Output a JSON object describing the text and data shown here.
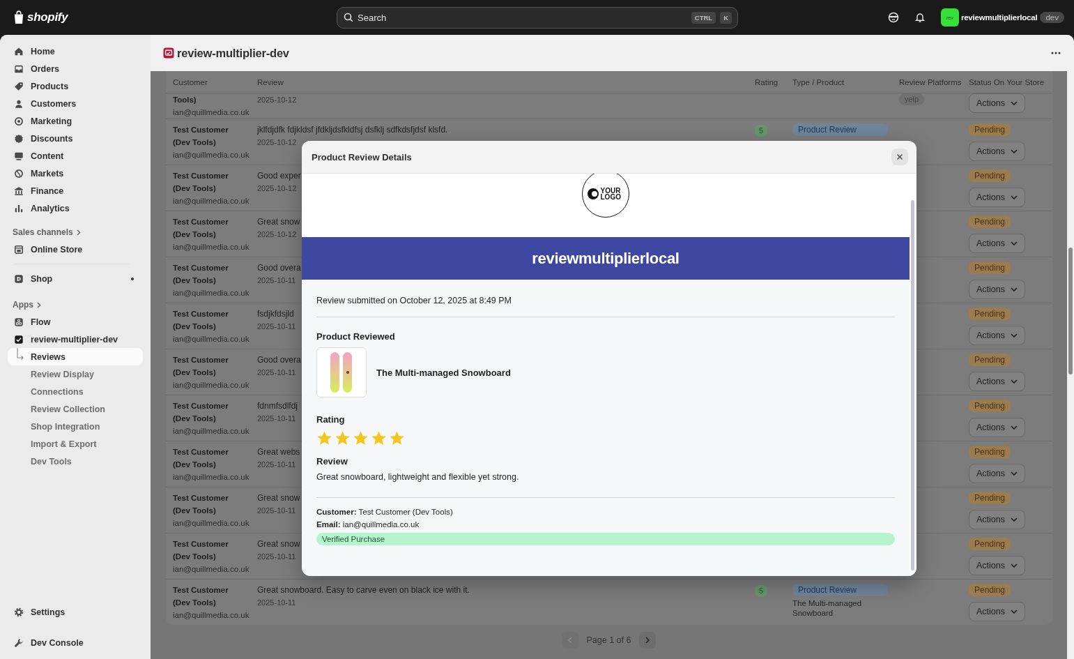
{
  "topbar": {
    "logo_text": "shopify",
    "search": {
      "placeholder": "Search",
      "shortcut": [
        "CTRL",
        "K"
      ]
    },
    "store": {
      "avatar_text": "rev",
      "name": "reviewmultiplierlocal",
      "badge": "dev"
    }
  },
  "sidebar": {
    "items": [
      {
        "label": "Home",
        "selected": false
      },
      {
        "label": "Orders",
        "selected": false
      },
      {
        "label": "Products",
        "selected": false
      },
      {
        "label": "Customers",
        "selected": false
      },
      {
        "label": "Marketing",
        "selected": false
      },
      {
        "label": "Discounts",
        "selected": false
      },
      {
        "label": "Content",
        "selected": false
      },
      {
        "label": "Markets",
        "selected": false
      },
      {
        "label": "Finance",
        "selected": false
      },
      {
        "label": "Analytics",
        "selected": false
      }
    ],
    "sales_channels": {
      "title": "Sales channels",
      "items": [
        {
          "label": "Online Store",
          "selected": false
        }
      ]
    },
    "pinned": [
      {
        "label": "Shop",
        "selected": false
      }
    ],
    "apps": {
      "title": "Apps",
      "items": [
        {
          "label": "Flow",
          "selected": false
        },
        {
          "label": "review-multiplier-dev",
          "selected": false,
          "expanded": true,
          "children": [
            {
              "label": "Reviews",
              "selected": true
            },
            {
              "label": "Review Display",
              "selected": false
            },
            {
              "label": "Connections",
              "selected": false
            },
            {
              "label": "Review Collection",
              "selected": false
            },
            {
              "label": "Shop Integration",
              "selected": false
            },
            {
              "label": "Import & Export",
              "selected": false
            },
            {
              "label": "Dev Tools",
              "selected": false
            }
          ]
        }
      ]
    },
    "footer_items": [
      {
        "label": "Settings",
        "selected": false
      },
      {
        "label": "Dev Console",
        "selected": false
      }
    ]
  },
  "page": {
    "title": "review-multiplier-dev"
  },
  "table": {
    "columns": [
      "Customer",
      "Review",
      "Rating",
      "Type / Product",
      "Review Platforms",
      "Status On Your Store"
    ],
    "rows": [
      {
        "customer": "Tools)",
        "email": "ian@quillmedia.co.uk",
        "date": "2025-10-12",
        "platforms": [
          "yelp"
        ],
        "actions": "Actions"
      },
      {
        "customer": "Test Customer (Dev Tools)",
        "email": "ian@quillmedia.co.uk",
        "review": "jklfdjdfk fdjkldsf jfdkljdsfkldfsj dsfklj sdfkdsfjdsf klsfd.",
        "date": "2025-10-12",
        "rating": "5",
        "type": "Product Review",
        "status": "Pending",
        "actions": "Actions"
      },
      {
        "customer": "Test Customer (Dev Tools)",
        "email": "ian@quillmedia.co.uk",
        "review": "Good exper",
        "date": "2025-10-12",
        "status": "Pending",
        "actions": "Actions"
      },
      {
        "customer": "Test Customer (Dev Tools)",
        "email": "ian@quillmedia.co.uk",
        "review": "Great snow",
        "date": "2025-10-12",
        "status": "Pending",
        "actions": "Actions"
      },
      {
        "customer": "Test Customer (Dev Tools)",
        "email": "ian@quillmedia.co.uk",
        "review": "Good overa",
        "date": "2025-10-11",
        "status": "Pending",
        "actions": "Actions"
      },
      {
        "customer": "Test Customer (Dev Tools)",
        "email": "ian@quillmedia.co.uk",
        "review": "fsdjkfdsjld",
        "date": "2025-10-11",
        "status": "Pending",
        "actions": "Actions"
      },
      {
        "customer": "Test Customer (Dev Tools)",
        "email": "ian@quillmedia.co.uk",
        "review": "Good overa",
        "date": "2025-10-11",
        "status": "Pending",
        "actions": "Actions"
      },
      {
        "customer": "Test Customer (Dev Tools)",
        "email": "ian@quillmedia.co.uk",
        "review": "fdnmfsdlfdj",
        "date": "2025-10-11",
        "status": "Pending",
        "actions": "Actions"
      },
      {
        "customer": "Test Customer (Dev Tools)",
        "email": "ian@quillmedia.co.uk",
        "review": "Great webs",
        "date": "2025-10-11",
        "status": "Pending",
        "actions": "Actions"
      },
      {
        "customer": "Test Customer (Dev Tools)",
        "email": "ian@quillmedia.co.uk",
        "review": "Great snow",
        "date": "2025-10-11",
        "status": "Pending",
        "actions": "Actions"
      },
      {
        "customer": "Test Customer (Dev Tools)",
        "email": "ian@quillmedia.co.uk",
        "review": "Great snow",
        "date": "2025-10-11",
        "status": "Pending",
        "actions": "Actions"
      },
      {
        "customer": "Test Customer (Dev Tools)",
        "email": "ian@quillmedia.co.uk",
        "review": "Great snowboard. Easy to carve even on black ice with it.",
        "date": "2025-10-11",
        "rating": "5",
        "type": "Product Review",
        "product": "The Multi-managed Snowboard",
        "status": "Pending",
        "actions": "Actions"
      }
    ]
  },
  "pagination": {
    "label": "Page 1 of 6",
    "prev_disabled": true,
    "next_disabled": false
  },
  "modal": {
    "title": "Product Review Details",
    "logo_text": "YOUR LOGO",
    "banner": "reviewmultiplierlocal",
    "submitted": "Review submitted on October 12, 2025 at 8:49 PM",
    "product_heading": "Product Reviewed",
    "product_name": "The Multi-managed Snowboard",
    "rating_heading": "Rating",
    "stars": 5,
    "review_heading": "Review",
    "review_text": "Great snowboard, lightweight and flexible yet strong.",
    "customer_line": "**Customer:** Test Customer (Dev Tools)",
    "email_line": "**Email:** ian@quillmedia.co.uk",
    "verified": "Verified Purchase"
  }
}
